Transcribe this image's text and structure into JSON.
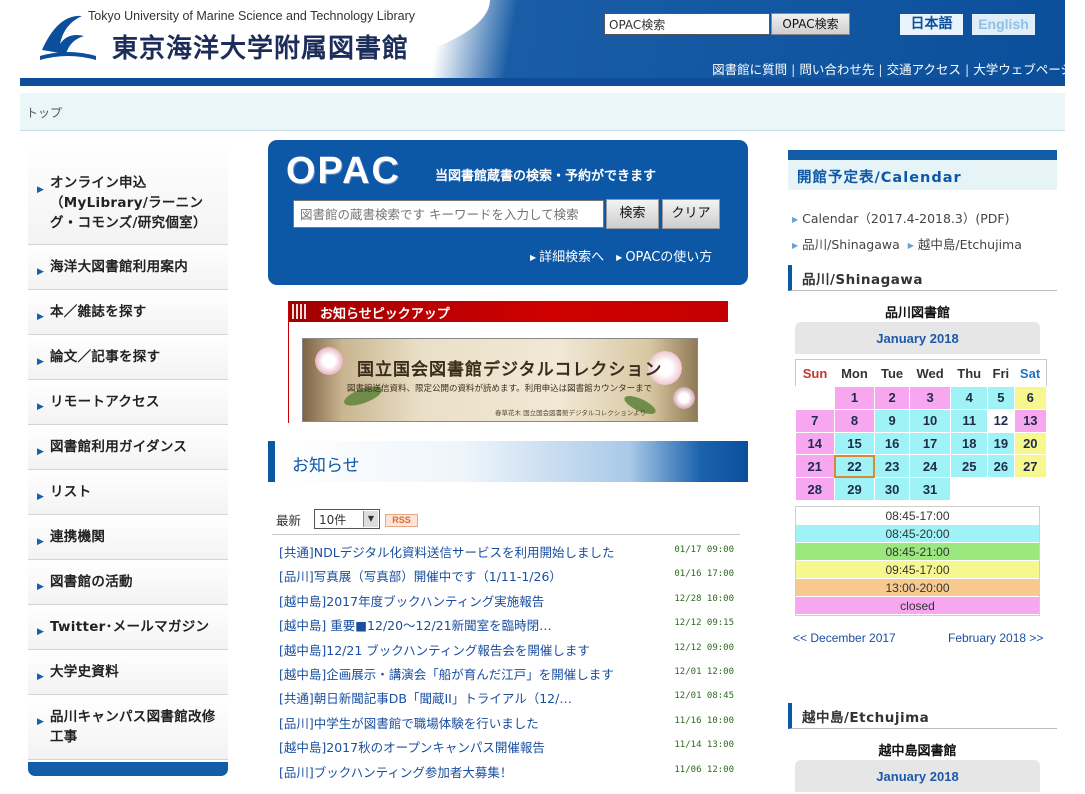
{
  "header": {
    "logo_en": "Tokyo University of Marine Science and Technology Library",
    "logo_jp": "東京海洋大学附属図書館",
    "opac_input_value": "OPAC検索",
    "opac_button": "OPAC検索",
    "lang_jp": "日本語",
    "lang_en": "English",
    "links": [
      "図書館に質問",
      "問い合わせ先",
      "交通アクセス",
      "大学ウェブページ"
    ]
  },
  "breadcrumb": "トップ",
  "leftnav": [
    "オンライン申込（MyLibrary/ラーニング・コモンズ/研究個室）",
    "海洋大図書館利用案内",
    "本／雑誌を探す",
    "論文／記事を探す",
    "リモートアクセス",
    "図書館利用ガイダンス",
    "リスト",
    "連携機関",
    "図書館の活動",
    "Twitter･メールマガジン",
    "大学史資料",
    "品川キャンパス図書館改修工事"
  ],
  "opac": {
    "title": "OPAC",
    "subtitle": "当図書館蔵書の検索・予約ができます",
    "placeholder": "図書館の蔵書検索です キーワードを入力して検索",
    "search_button": "検索",
    "clear_button": "クリア",
    "advanced_link": "詳細検索へ",
    "howto_link": "OPACの使い方"
  },
  "pickup": {
    "title": "お知らせピックアップ",
    "banner_title": "国立国会図書館デジタルコレクション",
    "banner_subtitle": "図書館送信資料、限定公開の資料が読めます。利用申込は図書館カウンターまで",
    "banner_caption": "春草花木 国立国会図書館デジタルコレクションより"
  },
  "news": {
    "heading": "お知らせ",
    "latest_label": "最新",
    "count_select": "10件",
    "rss_label": "RSS",
    "items": [
      {
        "title": "[共通]NDLデジタル化資料送信サービスを利用開始しました",
        "date": "01/17 09:00"
      },
      {
        "title": "[品川]写真展（写真部）開催中です（1/11-1/26）",
        "date": "01/16 17:00"
      },
      {
        "title": "[越中島]2017年度ブックハンティング実施報告",
        "date": "12/28 10:00"
      },
      {
        "title": "[越中島] 重要■12/20～12/21新聞室を臨時閉…",
        "date": "12/12 09:15"
      },
      {
        "title": "[越中島]12/21 ブックハンティング報告会を開催します",
        "date": "12/12 09:00"
      },
      {
        "title": "[越中島]企画展示・講演会「船が育んだ江戸」を開催します",
        "date": "12/01 12:00"
      },
      {
        "title": "[共通]朝日新聞記事DB「聞蔵II」トライアル（12/…",
        "date": "12/01 08:45"
      },
      {
        "title": "[品川]中学生が図書館で職場体験を行いました",
        "date": "11/16 10:00"
      },
      {
        "title": "[越中島]2017秋のオープンキャンパス開催報告",
        "date": "11/14 13:00"
      },
      {
        "title": "[品川]ブックハンティング参加者大募集！",
        "date": "11/06 12:00"
      }
    ]
  },
  "calendar_panel": {
    "heading": "開館予定表/Calendar",
    "links": {
      "calendar_pdf": "Calendar（2017.4-2018.3）(PDF)",
      "shinagawa": "品川/Shinagawa",
      "etchujima": "越中島/Etchujima"
    },
    "shinagawa_section": "品川/Shinagawa",
    "shinagawa_library": "品川図書館",
    "month": "January 2018",
    "weekdays": [
      "Sun",
      "Mon",
      "Tue",
      "Wed",
      "Thu",
      "Fri",
      "Sat"
    ],
    "legend": [
      "08:45-17:00",
      "08:45-20:00",
      "08:45-21:00",
      "09:45-17:00",
      "13:00-20:00",
      "closed"
    ],
    "legend_colors": [
      "#ffffff",
      "#9ff2f6",
      "#9be87f",
      "#f7f78f",
      "#f8c98f",
      "#f7a6f0"
    ],
    "prev_month": "<< December 2017",
    "next_month": "February 2018 >>",
    "etchujima_section": "越中島/Etchujima",
    "etchujima_library": "越中島図書館",
    "etchujima_month": "January 2018"
  },
  "calendar": {
    "rows": [
      [
        {
          "d": "",
          "s": "e"
        },
        {
          "d": "1",
          "s": "p"
        },
        {
          "d": "2",
          "s": "p"
        },
        {
          "d": "3",
          "s": "p"
        },
        {
          "d": "4",
          "s": "c"
        },
        {
          "d": "5",
          "s": "c"
        },
        {
          "d": "6",
          "s": "y"
        }
      ],
      [
        {
          "d": "7",
          "s": "p"
        },
        {
          "d": "8",
          "s": "p"
        },
        {
          "d": "9",
          "s": "c"
        },
        {
          "d": "10",
          "s": "c"
        },
        {
          "d": "11",
          "s": "c"
        },
        {
          "d": "12",
          "s": "w"
        },
        {
          "d": "13",
          "s": "p"
        }
      ],
      [
        {
          "d": "14",
          "s": "p"
        },
        {
          "d": "15",
          "s": "c"
        },
        {
          "d": "16",
          "s": "c"
        },
        {
          "d": "17",
          "s": "c"
        },
        {
          "d": "18",
          "s": "c"
        },
        {
          "d": "19",
          "s": "c"
        },
        {
          "d": "20",
          "s": "y"
        }
      ],
      [
        {
          "d": "21",
          "s": "p"
        },
        {
          "d": "22",
          "s": "today"
        },
        {
          "d": "23",
          "s": "c"
        },
        {
          "d": "24",
          "s": "c"
        },
        {
          "d": "25",
          "s": "c"
        },
        {
          "d": "26",
          "s": "c"
        },
        {
          "d": "27",
          "s": "y"
        }
      ],
      [
        {
          "d": "28",
          "s": "p"
        },
        {
          "d": "29",
          "s": "c"
        },
        {
          "d": "30",
          "s": "c"
        },
        {
          "d": "31",
          "s": "c"
        },
        {
          "d": "",
          "s": "e"
        },
        {
          "d": "",
          "s": "e"
        },
        {
          "d": "",
          "s": "e"
        }
      ]
    ]
  }
}
